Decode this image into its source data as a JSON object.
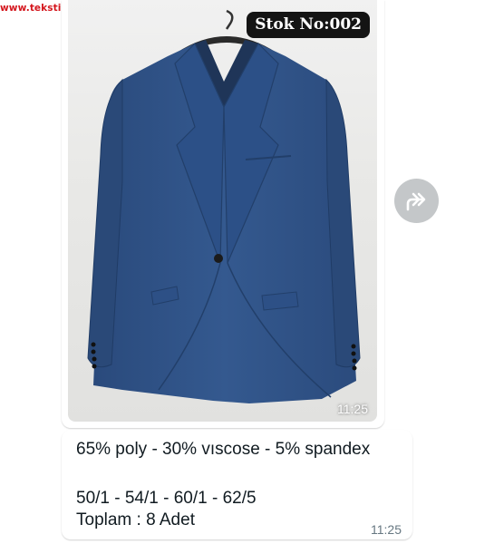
{
  "watermark": {
    "text": "www.tekstilportal.com"
  },
  "image_message": {
    "stock_label": "Stok No:002",
    "time": "11:25"
  },
  "forward": {
    "icon": "forward-arrow-icon"
  },
  "text_message": {
    "line1": "65% poly - 30% vıscose - 5% spandex",
    "line2": "50/1 - 54/1 - 60/1 - 62/5",
    "line3": "Toplam : 8 Adet",
    "time": "11:25"
  },
  "colors": {
    "suit": "#2f5387",
    "badge_bg": "#141414",
    "watermark": "#d4161d",
    "forward_bg": "#c4c7c9"
  }
}
